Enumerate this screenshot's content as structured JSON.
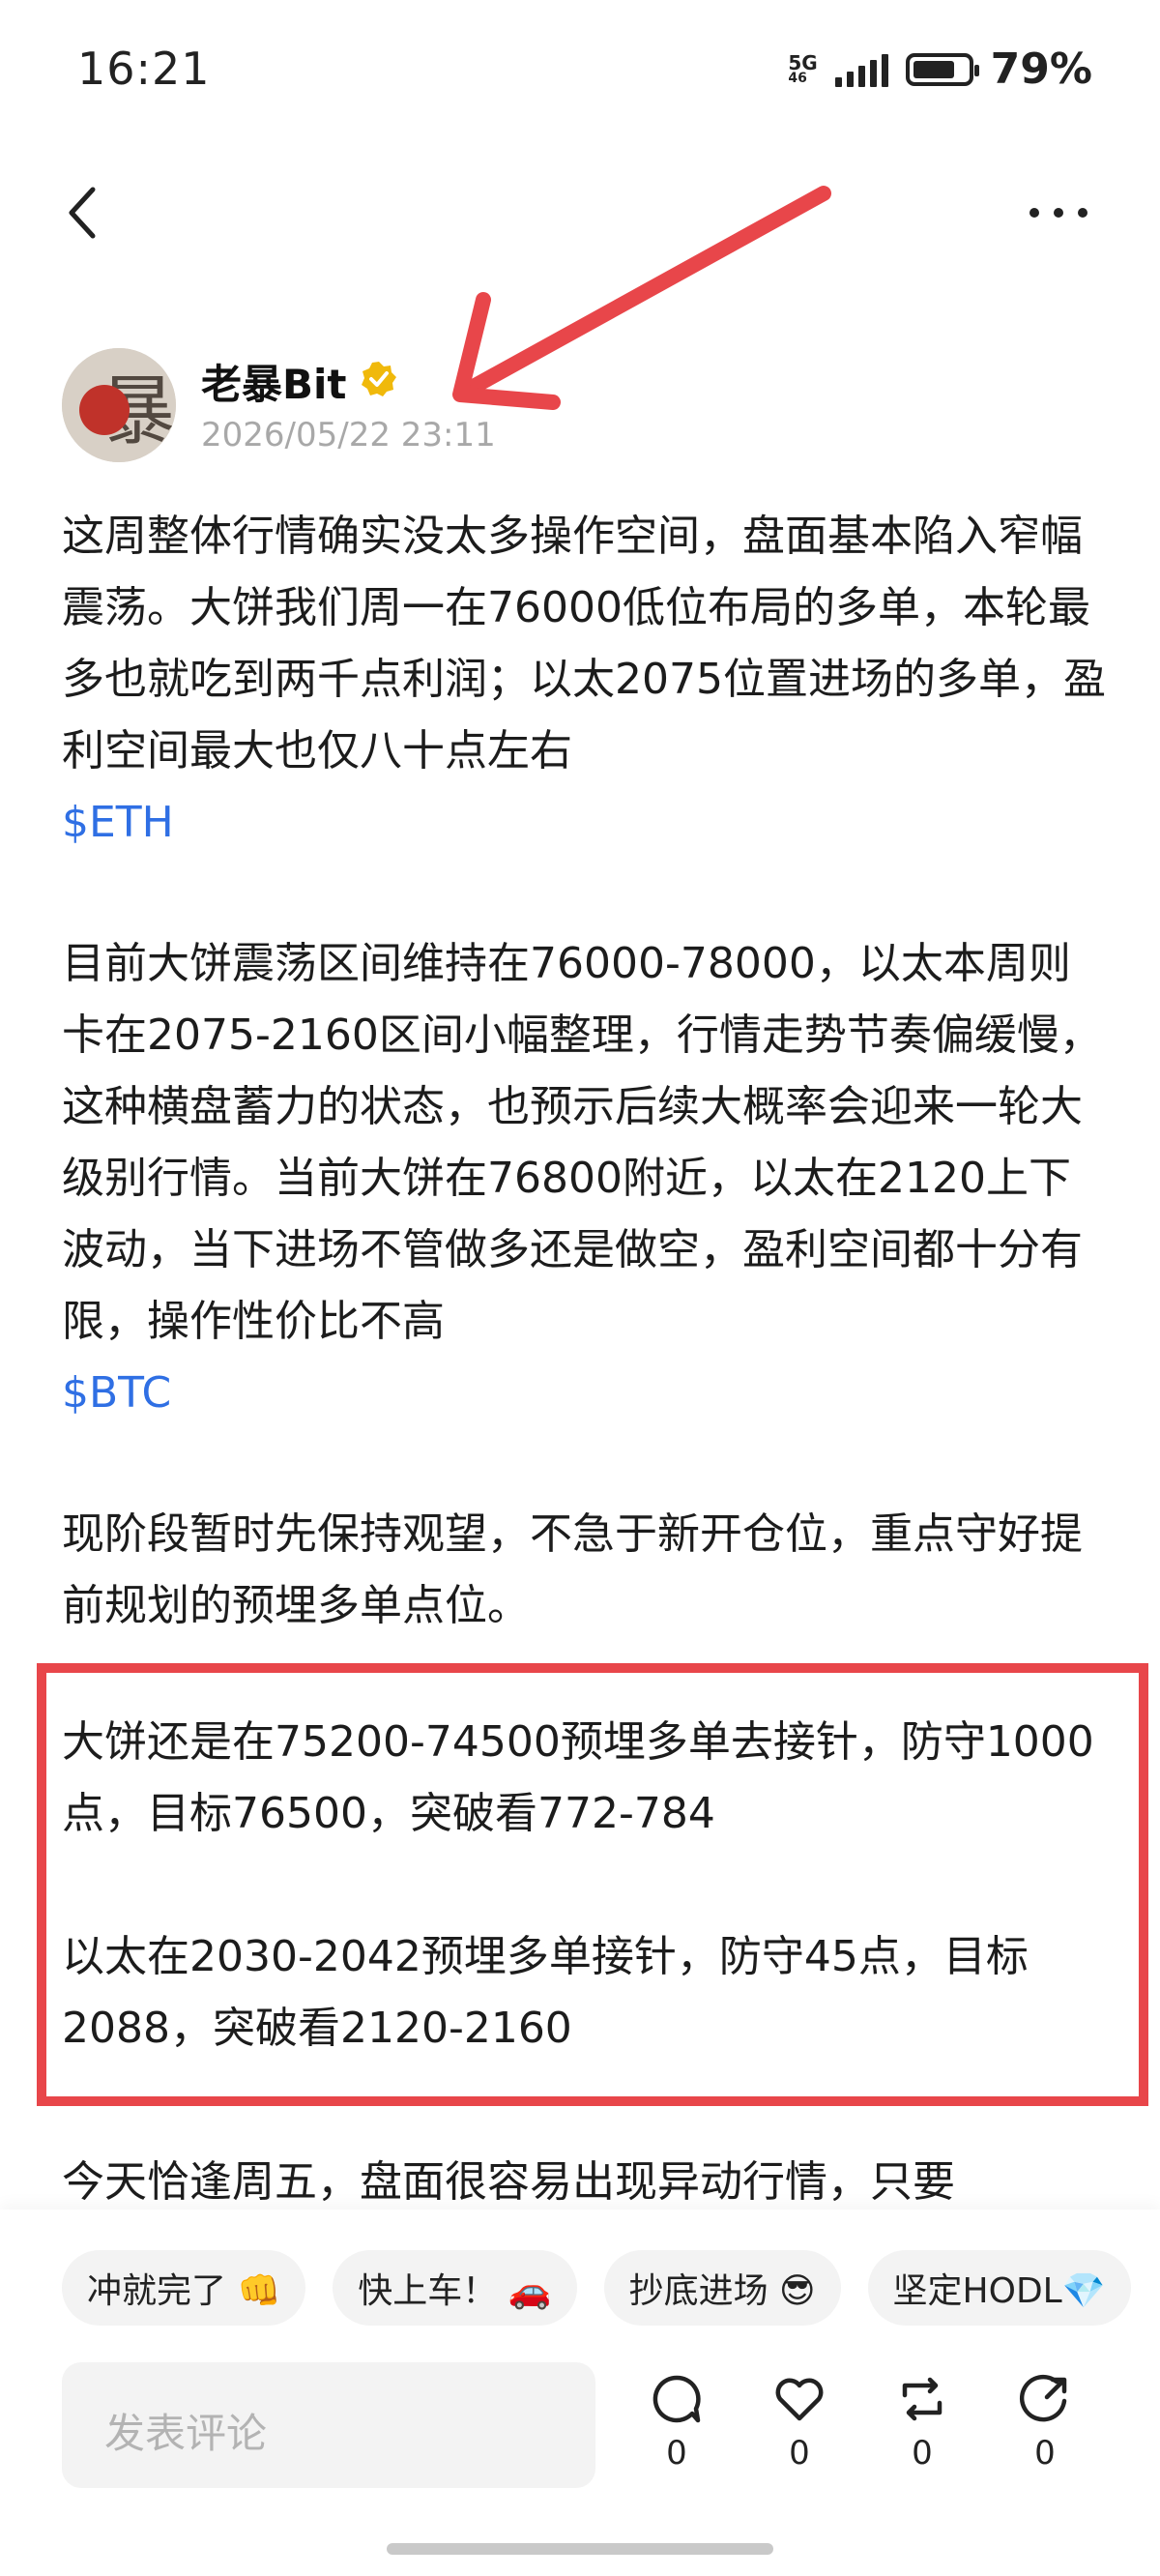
{
  "status_bar": {
    "time": "16:21",
    "network_top": "5G",
    "network_bottom": "46",
    "battery": "79%",
    "battery_level": 0.79
  },
  "author": {
    "name": "老暴Bit",
    "date": "2026/05/22 23:11",
    "avatar_text": "老暴"
  },
  "post": {
    "p1": "这周整体行情确实没太多操作空间，盘面基本陷入窄幅震荡。大饼我们周一在76000低位布局的多单，本轮最多也就吃到两千点利润；以太2075位置进场的多单，盈利空间最大也仅八十点左右",
    "tag1": "$ETH",
    "p2": "目前大饼震荡区间维持在76000-78000，以太本周则卡在2075-2160区间小幅整理，行情走势节奏偏缓慢，这种横盘蓄力的状态，也预示后续大概率会迎来一轮大级别行情。当前大饼在76800附近，以太在2120上下波动，当下进场不管做多还是做空，盈利空间都十分有限，操作性价比不高",
    "tag2": "$BTC",
    "p3": "现阶段暂时先保持观望，不急于新开仓位，重点守好提前规划的预埋多单点位。",
    "p4": "大饼还是在75200-74500预埋多单去接针，防守1000点，目标76500，突破看772-784",
    "p5": "以太在2030-2042预埋多单接针，防守45点，目标2088，突破看2120-2160",
    "p6": "今天恰逢周五，盘面很容易出现异动行情，只要"
  },
  "reactions": [
    "冲就完了 👊",
    "快上车！ 🚗",
    "抄底进场 😎",
    "坚定HODL💎"
  ],
  "comment": {
    "placeholder": "发表评论"
  },
  "actions": {
    "comment_count": "0",
    "like_count": "0",
    "repost_count": "0",
    "share_count": "0"
  },
  "colors": {
    "accent_link": "#2f6fe4",
    "annotation_red": "#e8464a",
    "verified_gold": "#f0b90b"
  }
}
